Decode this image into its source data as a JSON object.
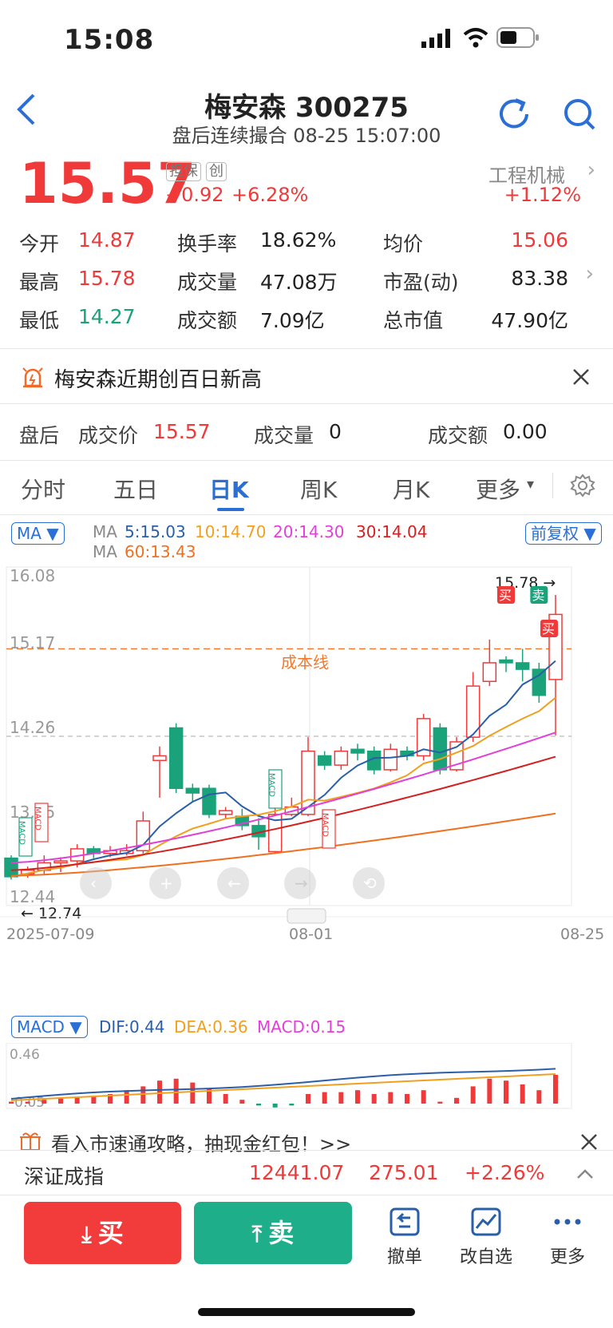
{
  "status": {
    "time": "15:08"
  },
  "header": {
    "title": "梅安森 300275",
    "subtitle": "盘后连续撮合 08-25 15:07:00"
  },
  "quote": {
    "price": "15.57",
    "tag1": "担保",
    "tag2": "创",
    "change": "+0.92",
    "change_pct": "+6.28%",
    "sector": "工程机械",
    "sector_chg": "+1.12%"
  },
  "stats": [
    {
      "label": "今开",
      "value": "14.87",
      "color": "#f03a3a"
    },
    {
      "label": "换手率",
      "value": "18.62%",
      "color": "#222222"
    },
    {
      "label": "均价",
      "value": "15.06",
      "color": "#f03a3a"
    },
    {
      "label": "最高",
      "value": "15.78",
      "color": "#f03a3a"
    },
    {
      "label": "成交量",
      "value": "47.08万",
      "color": "#222222"
    },
    {
      "label": "市盈(动)",
      "value": "83.38",
      "color": "#222222"
    },
    {
      "label": "最低",
      "value": "14.27",
      "color": "#1aa27a"
    },
    {
      "label": "成交额",
      "value": "7.09亿",
      "color": "#222222"
    },
    {
      "label": "总市值",
      "value": "47.90亿",
      "color": "#222222"
    }
  ],
  "notice": {
    "text": "梅安森近期创百日新高"
  },
  "afterhours": {
    "label": "盘后",
    "price_label": "成交价",
    "price": "15.57",
    "vol_label": "成交量",
    "vol": "0",
    "amt_label": "成交额",
    "amt": "0.00"
  },
  "tabs": [
    {
      "label": "分时"
    },
    {
      "label": "五日"
    },
    {
      "label": "日K"
    },
    {
      "label": "周K"
    },
    {
      "label": "月K"
    },
    {
      "label": "更多"
    }
  ],
  "ma": {
    "selector": "MA",
    "prefix": "MA",
    "ma5": "5:15.03",
    "ma10": "10:14.70",
    "ma20": "20:14.30",
    "ma30": "30:14.04",
    "ma60": "60:13.43",
    "fq": "前复权"
  },
  "chart_data": {
    "type": "candlestick",
    "y_ticks": [
      "16.08",
      "15.17",
      "14.26",
      "13.35",
      "12.44"
    ],
    "ylim": [
      12.44,
      16.08
    ],
    "x_labels": [
      "2025-07-09",
      "08-01",
      "08-25"
    ],
    "high_label": "15.78",
    "low_label": "12.74",
    "cost_line_label": "成本线",
    "cost_line_value": 15.2,
    "signals": [
      "买",
      "卖",
      "买"
    ],
    "macd_markers": [
      "MACD",
      "MACD",
      "MACD",
      "MACD"
    ]
  },
  "macd": {
    "selector": "MACD",
    "dif": "DIF:0.44",
    "dea": "DEA:0.36",
    "macd": "MACD:0.15",
    "top": "0.46",
    "bottom": "-0.05"
  },
  "promo": {
    "text": "看入市速通攻略，抽现金红包！>>"
  },
  "index": {
    "name": "深证成指",
    "value": "12441.07",
    "change": "275.01",
    "pct": "+2.26%"
  },
  "bottom": {
    "buy": "买",
    "sell": "卖",
    "cancel": "撤单",
    "watch": "改自选",
    "more": "更多"
  }
}
